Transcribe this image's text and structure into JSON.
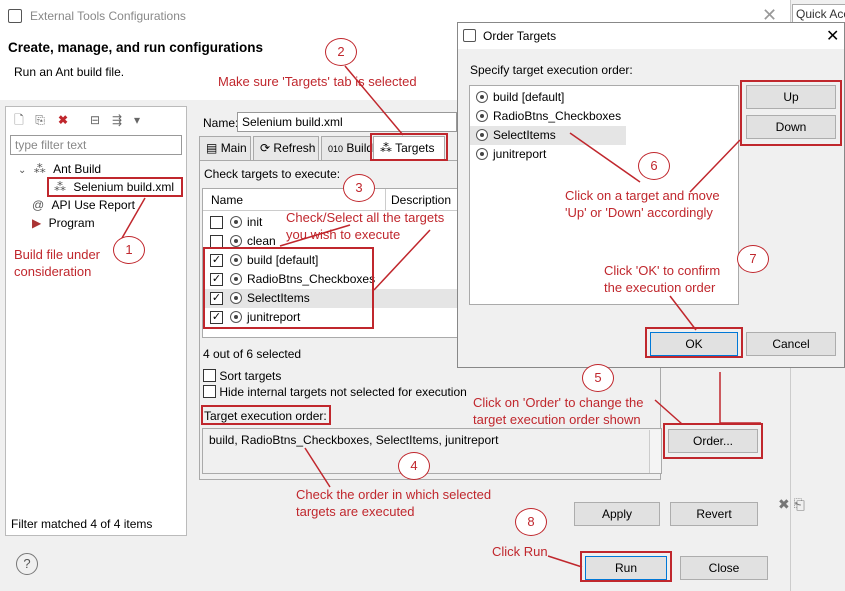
{
  "window": {
    "title": "External Tools Configurations",
    "header_title": "Create, manage, and run configurations",
    "header_subtitle": "Run an Ant build file.",
    "quick_access": "Quick Acc"
  },
  "left": {
    "filter_placeholder": "type filter text",
    "tree": [
      {
        "label": "Ant Build"
      },
      {
        "label": "Selenium build.xml"
      },
      {
        "label": "API Use Report"
      },
      {
        "label": "Program"
      }
    ],
    "status": "Filter matched 4 of 4 items"
  },
  "config": {
    "name_label": "Name:",
    "name_value": "Selenium build.xml",
    "tabs": [
      "Main",
      "Refresh",
      "Build",
      "Targets"
    ],
    "check_label": "Check targets to execute:",
    "col_name": "Name",
    "col_desc": "Description",
    "targets": [
      {
        "label": "init",
        "checked": false
      },
      {
        "label": "clean",
        "checked": false
      },
      {
        "label": "build [default]",
        "checked": true
      },
      {
        "label": "RadioBtns_Checkboxes",
        "checked": true
      },
      {
        "label": "SelectItems",
        "checked": true
      },
      {
        "label": "junitreport",
        "checked": true
      }
    ],
    "count_text": "4 out of 6 selected",
    "sort_targets": "Sort targets",
    "hide_internal": "Hide internal targets not selected for execution",
    "order_label": "Target execution order:",
    "order_value": "build, RadioBtns_Checkboxes, SelectItems, junitreport",
    "order_button": "Order...",
    "apply": "Apply",
    "revert": "Revert",
    "run": "Run",
    "close": "Close",
    "help": "?"
  },
  "dialog": {
    "title": "Order Targets",
    "instruction": "Specify target execution order:",
    "items": [
      "build [default]",
      "RadioBtns_Checkboxes",
      "SelectItems",
      "junitreport"
    ],
    "up": "Up",
    "down": "Down",
    "ok": "OK",
    "cancel": "Cancel"
  },
  "annotations": {
    "a1": "Build file under\nconsideration",
    "a2": "Make sure 'Targets' tab is selected",
    "a3": "Check/Select all the targets\nyou wish to execute",
    "a4": "Check the order in which selected\ntargets are executed",
    "a5": "Click on 'Order' to change the\ntarget execution order shown",
    "a6": "Click on a target and move\n'Up' or 'Down' accordingly",
    "a7": "Click 'OK' to confirm\nthe execution order",
    "a8": "Click Run",
    "n1": "1",
    "n2": "2",
    "n3": "3",
    "n4": "4",
    "n5": "5",
    "n6": "6",
    "n7": "7",
    "n8": "8"
  },
  "colors": {
    "annotation": "#c0272d"
  }
}
